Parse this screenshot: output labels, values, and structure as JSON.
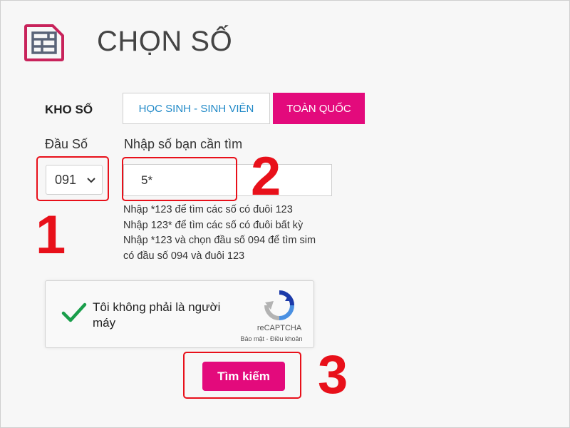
{
  "header": {
    "title": "CHỌN SỐ",
    "icon": "sim-card-icon"
  },
  "kho_so": {
    "label": "KHO SỐ",
    "tabs": [
      {
        "label": "HỌC SINH - SINH VIÊN",
        "active": false
      },
      {
        "label": "TOÀN QUỐC",
        "active": true
      }
    ]
  },
  "dau_so": {
    "label": "Đầu Số",
    "selected": "091"
  },
  "search": {
    "label": "Nhập số bạn cần tìm",
    "value": "5*",
    "hints": [
      "Nhập *123 để tìm các số có đuôi 123",
      "Nhập 123* để tìm các số có đuôi bất kỳ",
      "Nhập *123 và chọn đầu số 094 để tìm sim",
      "có đầu số 094 và đuôi 123"
    ]
  },
  "captcha": {
    "text": "Tôi không phải là người máy",
    "checked": true,
    "brand": "reCAPTCHA",
    "links": "Bảo mật - Điều khoản"
  },
  "submit": {
    "label": "Tìm kiếm"
  },
  "annotations": [
    "1",
    "2",
    "3"
  ],
  "colors": {
    "accent": "#e30a7c",
    "annotation": "#e8101a",
    "link": "#1e88c7",
    "check": "#1a9e4b"
  }
}
